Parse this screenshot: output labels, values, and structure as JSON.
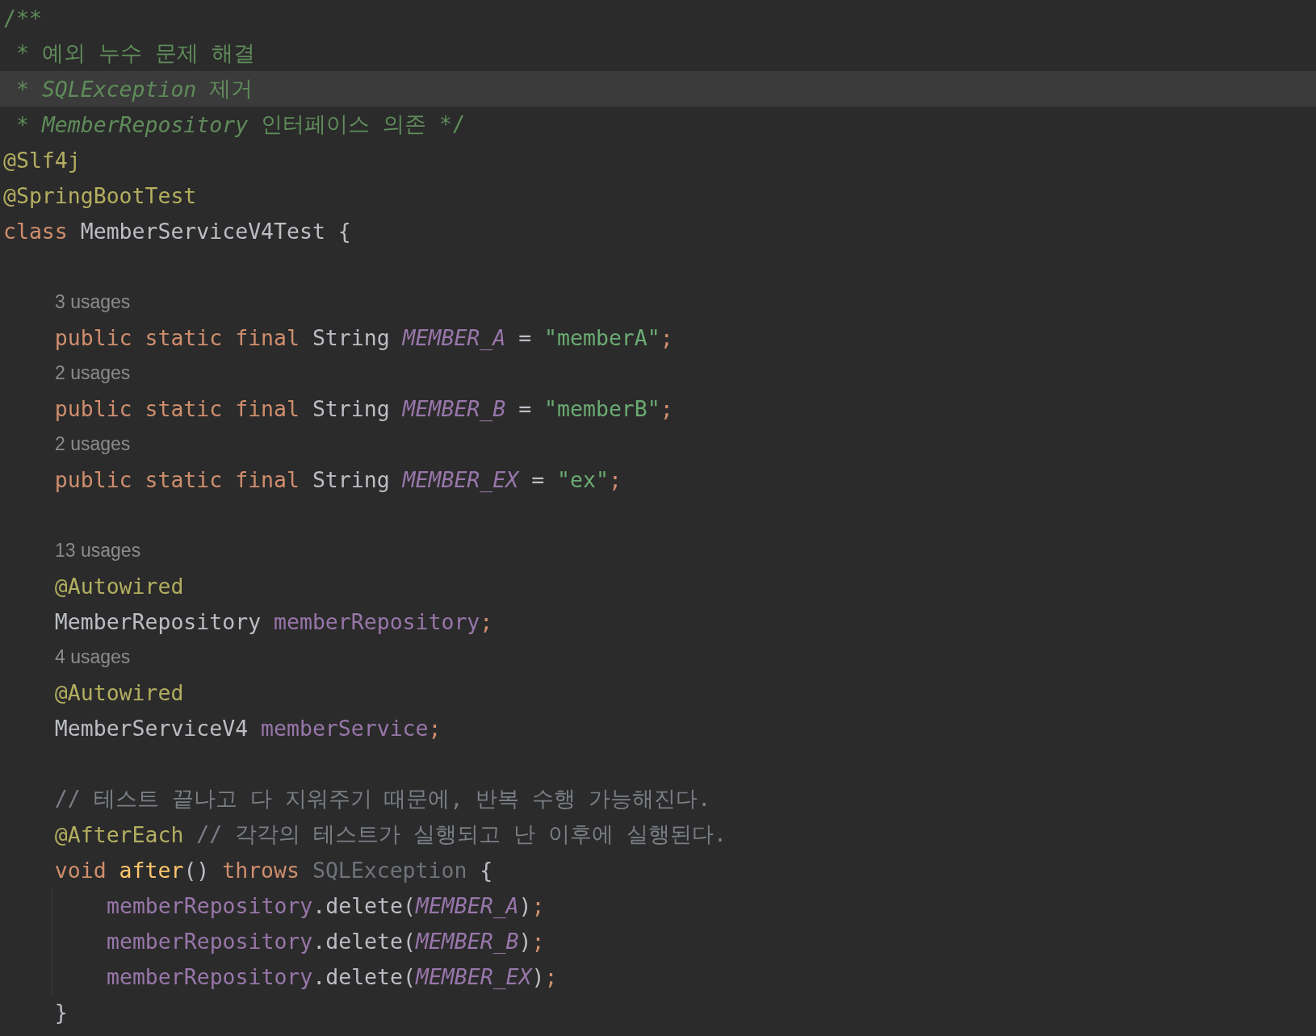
{
  "editor": {
    "lines": [
      {
        "kind": "code",
        "current": false,
        "tokens": [
          {
            "kind": "doc",
            "text": "/**"
          }
        ]
      },
      {
        "kind": "code",
        "current": false,
        "tokens": [
          {
            "kind": "doc",
            "text": " * 예외 누수 문제 해결"
          }
        ]
      },
      {
        "kind": "code",
        "current": true,
        "tokens": [
          {
            "kind": "doc",
            "text": " * "
          },
          {
            "kind": "docref",
            "text": "SQLException"
          },
          {
            "kind": "doc",
            "text": " 제거"
          }
        ]
      },
      {
        "kind": "code",
        "current": false,
        "tokens": [
          {
            "kind": "doc",
            "text": " * "
          },
          {
            "kind": "docref",
            "text": "MemberRepository"
          },
          {
            "kind": "doc",
            "text": " 인터페이스 의존 */"
          }
        ]
      },
      {
        "kind": "code",
        "current": false,
        "tokens": [
          {
            "kind": "annotation",
            "text": "@Slf4j"
          }
        ]
      },
      {
        "kind": "code",
        "current": false,
        "tokens": [
          {
            "kind": "annotation",
            "text": "@SpringBootTest"
          }
        ]
      },
      {
        "kind": "code",
        "current": false,
        "tokens": [
          {
            "kind": "keyword",
            "text": "class "
          },
          {
            "kind": "plain",
            "text": "MemberServiceV4Test {"
          }
        ]
      },
      {
        "kind": "blank",
        "current": false
      },
      {
        "kind": "hint",
        "current": false,
        "text": "3 usages"
      },
      {
        "kind": "code",
        "current": false,
        "tokens": [
          {
            "kind": "keyword",
            "text": "    public static final "
          },
          {
            "kind": "plain",
            "text": "String "
          },
          {
            "kind": "constant",
            "text": "MEMBER_A"
          },
          {
            "kind": "plain",
            "text": " = "
          },
          {
            "kind": "string",
            "text": "\"memberA\""
          },
          {
            "kind": "keyword",
            "text": ";"
          }
        ]
      },
      {
        "kind": "hint",
        "current": false,
        "text": "2 usages"
      },
      {
        "kind": "code",
        "current": false,
        "tokens": [
          {
            "kind": "keyword",
            "text": "    public static final "
          },
          {
            "kind": "plain",
            "text": "String "
          },
          {
            "kind": "constant",
            "text": "MEMBER_B"
          },
          {
            "kind": "plain",
            "text": " = "
          },
          {
            "kind": "string",
            "text": "\"memberB\""
          },
          {
            "kind": "keyword",
            "text": ";"
          }
        ]
      },
      {
        "kind": "hint",
        "current": false,
        "text": "2 usages"
      },
      {
        "kind": "code",
        "current": false,
        "tokens": [
          {
            "kind": "keyword",
            "text": "    public static final "
          },
          {
            "kind": "plain",
            "text": "String "
          },
          {
            "kind": "constant",
            "text": "MEMBER_EX"
          },
          {
            "kind": "plain",
            "text": " = "
          },
          {
            "kind": "string",
            "text": "\"ex\""
          },
          {
            "kind": "keyword",
            "text": ";"
          }
        ]
      },
      {
        "kind": "blank",
        "current": false
      },
      {
        "kind": "hint",
        "current": false,
        "text": "13 usages"
      },
      {
        "kind": "code",
        "current": false,
        "tokens": [
          {
            "kind": "annotation",
            "text": "    @Autowired"
          }
        ]
      },
      {
        "kind": "code",
        "current": false,
        "tokens": [
          {
            "kind": "plain",
            "text": "    MemberRepository "
          },
          {
            "kind": "field",
            "text": "memberRepository"
          },
          {
            "kind": "keyword",
            "text": ";"
          }
        ]
      },
      {
        "kind": "hint",
        "current": false,
        "text": "4 usages"
      },
      {
        "kind": "code",
        "current": false,
        "tokens": [
          {
            "kind": "annotation",
            "text": "    @Autowired"
          }
        ]
      },
      {
        "kind": "code",
        "current": false,
        "tokens": [
          {
            "kind": "plain",
            "text": "    MemberServiceV4 "
          },
          {
            "kind": "field",
            "text": "memberService"
          },
          {
            "kind": "keyword",
            "text": ";"
          }
        ]
      },
      {
        "kind": "blank",
        "current": false
      },
      {
        "kind": "code",
        "current": false,
        "tokens": [
          {
            "kind": "comment",
            "text": "    // 테스트 끝나고 다 지워주기 때문에, 반복 수행 가능해진다."
          }
        ]
      },
      {
        "kind": "code",
        "current": false,
        "tokens": [
          {
            "kind": "annotation",
            "text": "    @AfterEach"
          },
          {
            "kind": "comment",
            "text": " // 각각의 테스트가 실행되고 난 이후에 실행된다."
          }
        ]
      },
      {
        "kind": "code",
        "current": false,
        "tokens": [
          {
            "kind": "keyword",
            "text": "    void "
          },
          {
            "kind": "method",
            "text": "after"
          },
          {
            "kind": "plain",
            "text": "() "
          },
          {
            "kind": "keyword",
            "text": "throws "
          },
          {
            "kind": "unused",
            "text": "SQLException"
          },
          {
            "kind": "plain",
            "text": " {"
          }
        ],
        "children": [
          {
            "kind": "code",
            "current": false,
            "tokens": [
              {
                "kind": "field",
                "text": "memberRepository"
              },
              {
                "kind": "plain",
                "text": ".delete("
              },
              {
                "kind": "constant",
                "text": "MEMBER_A"
              },
              {
                "kind": "plain",
                "text": ")"
              },
              {
                "kind": "keyword",
                "text": ";"
              }
            ]
          },
          {
            "kind": "code",
            "current": false,
            "tokens": [
              {
                "kind": "field",
                "text": "memberRepository"
              },
              {
                "kind": "plain",
                "text": ".delete("
              },
              {
                "kind": "constant",
                "text": "MEMBER_B"
              },
              {
                "kind": "plain",
                "text": ")"
              },
              {
                "kind": "keyword",
                "text": ";"
              }
            ]
          },
          {
            "kind": "code",
            "current": false,
            "tokens": [
              {
                "kind": "field",
                "text": "memberRepository"
              },
              {
                "kind": "plain",
                "text": ".delete("
              },
              {
                "kind": "constant",
                "text": "MEMBER_EX"
              },
              {
                "kind": "plain",
                "text": ")"
              },
              {
                "kind": "keyword",
                "text": ";"
              }
            ]
          }
        ]
      },
      {
        "kind": "code",
        "current": false,
        "tokens": [
          {
            "kind": "plain",
            "text": "    }"
          }
        ]
      }
    ]
  }
}
